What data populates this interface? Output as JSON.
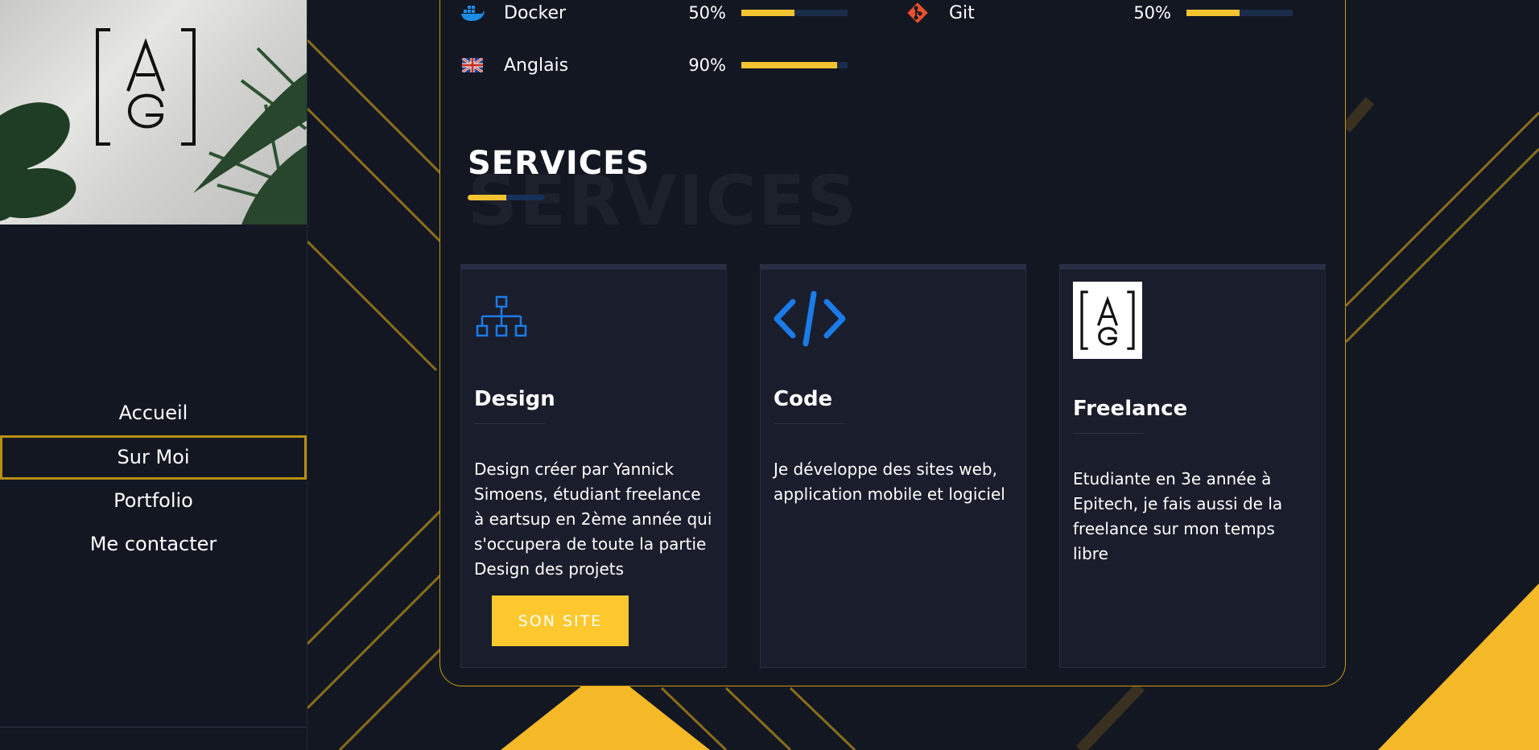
{
  "nav": {
    "items": [
      "Accueil",
      "Sur Moi",
      "Portfolio",
      "Me contacter"
    ],
    "active": "Sur Moi"
  },
  "skills": [
    {
      "name": "Docker",
      "percent": "50%",
      "level": 0.5,
      "icon": "docker-icon"
    },
    {
      "name": "Git",
      "percent": "50%",
      "level": 0.5,
      "icon": "git-icon"
    },
    {
      "name": "Anglais",
      "percent": "90%",
      "level": 0.9,
      "icon": "uk-flag-icon"
    }
  ],
  "services": {
    "title": "SERVICES",
    "ghost": "SERVICES",
    "cards": [
      {
        "title": "Design",
        "description": "Design créer par Yannick Simoens, étudiant freelance à eartsup en 2ème année qui s'occupera de toute la partie Design des projets",
        "button": "SON SITE",
        "icon": "sitemap-icon"
      },
      {
        "title": "Code",
        "description": "Je développe des sites web, application mobile et logiciel",
        "icon": "code-icon"
      },
      {
        "title": "Freelance",
        "description": "Etudiante en 3e année à Epitech, je fais aussi de la freelance sur mon temps libre",
        "icon": "ag-logo-icon"
      }
    ]
  },
  "colors": {
    "accent": "#f4c430",
    "background": "#131722",
    "card_border": "#c99a12",
    "icon_blue": "#1b7be8"
  }
}
